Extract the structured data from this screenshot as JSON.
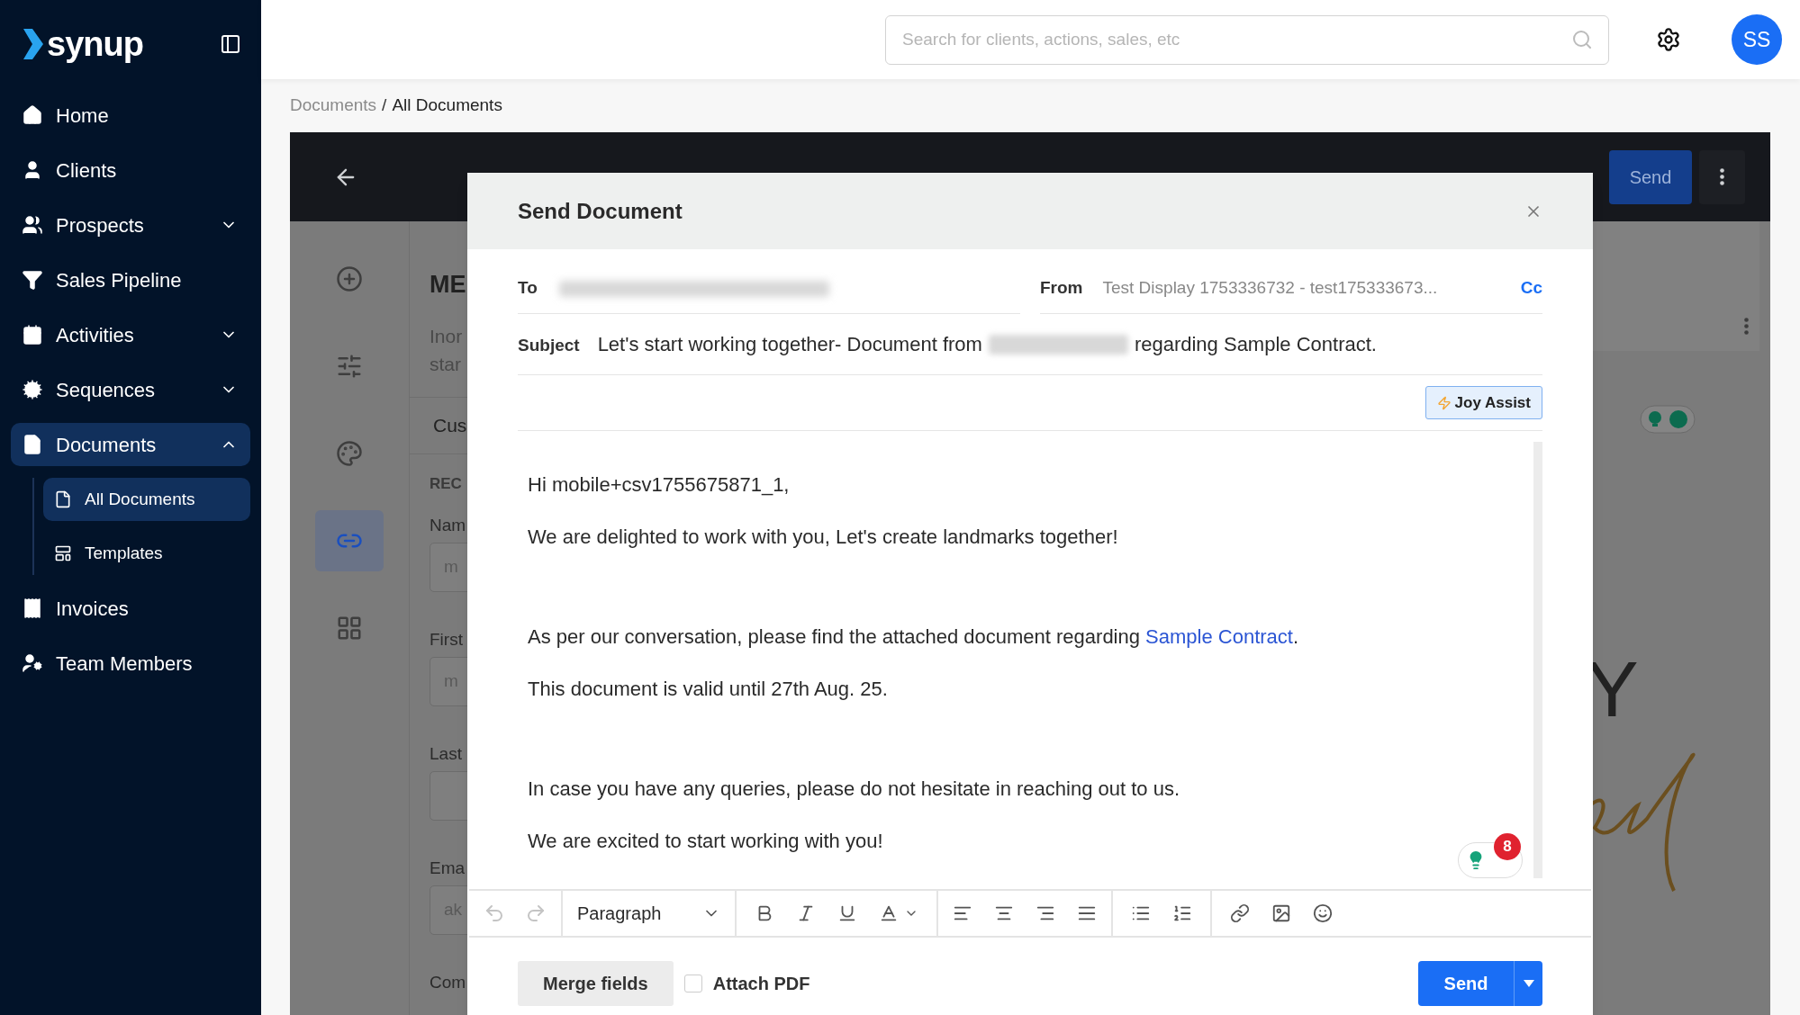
{
  "brand": {
    "name": "synup"
  },
  "sidebar": {
    "items": [
      {
        "label": "Home",
        "selected": false
      },
      {
        "label": "Clients",
        "selected": false
      },
      {
        "label": "Prospects",
        "expanded": false,
        "selected": false
      },
      {
        "label": "Sales Pipeline",
        "selected": false
      },
      {
        "label": "Activities",
        "expanded": false,
        "selected": false
      },
      {
        "label": "Sequences",
        "expanded": false,
        "selected": false
      },
      {
        "label": "Documents",
        "expanded": true,
        "selected": true,
        "children": [
          {
            "label": "All Documents",
            "selected": true
          },
          {
            "label": "Templates",
            "selected": false
          }
        ]
      },
      {
        "label": "Invoices",
        "selected": false
      },
      {
        "label": "Team Members",
        "selected": false
      }
    ]
  },
  "header": {
    "search": {
      "placeholder": "Search for clients, actions, sales, etc"
    },
    "avatar": "SS"
  },
  "breadcrumb": {
    "separator": "/",
    "items": [
      {
        "label": "Documents",
        "current": false
      },
      {
        "label": "All Documents",
        "current": true
      }
    ]
  },
  "editor": {
    "send_button": "Send",
    "rail": [
      {
        "selected": false
      },
      {
        "selected": false
      },
      {
        "selected": false
      },
      {
        "selected": true
      },
      {
        "selected": false
      }
    ],
    "form_fragments": [
      {
        "kind": "heading",
        "text": "ME"
      },
      {
        "kind": "paragraph",
        "text": "Inor"
      },
      {
        "kind": "paragraph",
        "text": "star"
      },
      {
        "kind": "tab",
        "text": "Cus"
      },
      {
        "kind": "section",
        "text": "REC"
      },
      {
        "kind": "label",
        "text": "Nam"
      },
      {
        "kind": "input",
        "text": "m"
      },
      {
        "kind": "label",
        "text": "First"
      },
      {
        "kind": "input",
        "text": "m"
      },
      {
        "kind": "label",
        "text": "Last"
      },
      {
        "kind": "input"
      },
      {
        "kind": "label",
        "text": "Ema"
      },
      {
        "kind": "input",
        "text": "ak"
      },
      {
        "kind": "label",
        "text": "Com"
      }
    ],
    "document_letter": "Y"
  },
  "dialog": {
    "title": "Send Document",
    "to": {
      "label": "To"
    },
    "from": {
      "label": "From",
      "value": "Test Display 1753336732 - test175333673..."
    },
    "cc": "Cc",
    "subject": {
      "label": "Subject",
      "before": "Let's start working together- Document from",
      "after": "regarding Sample Contract."
    },
    "joy_assist": "Joy Assist",
    "body": [
      {
        "lines": [
          {
            "text": "Hi mobile+csv1755675871_1,"
          },
          {
            "text": "We are delighted to work with you, Let's create landmarks together!"
          }
        ]
      },
      {
        "lines": [
          {
            "text": "As per our conversation, please find the attached document regarding ",
            "link": "Sample Contract",
            "after": "."
          },
          {
            "text": "This document is valid until 27th Aug. 25."
          }
        ]
      },
      {
        "lines": [
          {
            "text": "In case you have any queries, please do not hesitate in reaching out to us."
          },
          {
            "text": "We are excited to start working with you!"
          }
        ]
      }
    ],
    "grammar_count": "8",
    "toolbar": {
      "block_format": "Paragraph",
      "undo_disabled": true,
      "redo_disabled": true
    },
    "merge_fields": "Merge fields",
    "attach_pdf": {
      "label": "Attach PDF",
      "checked": false
    },
    "send": "Send"
  }
}
